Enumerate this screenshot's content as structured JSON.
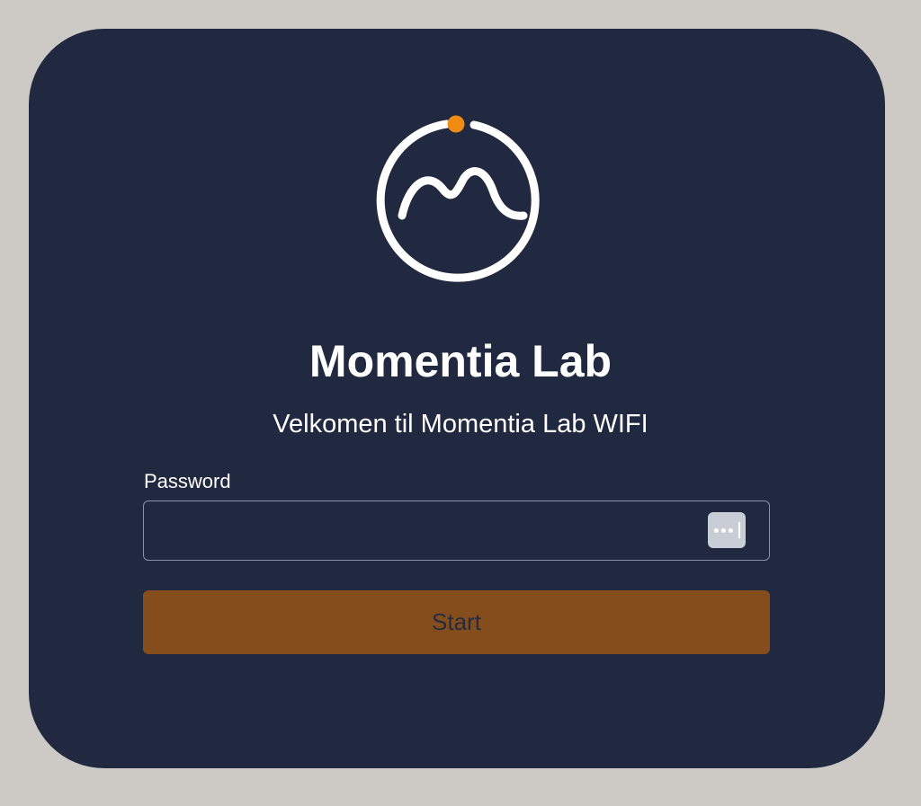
{
  "brand": {
    "logo_icon": "momentia-logo-icon",
    "title": "Momentia Lab",
    "subtitle": "Velkomen til Momentia Lab WIFI"
  },
  "form": {
    "password_label": "Password",
    "password_value": "",
    "password_manager_icon": "password-key-icon",
    "submit_label": "Start"
  },
  "colors": {
    "background": "#cdc9c5",
    "card": "#212940",
    "accent_orange": "#f08b12",
    "button": "#854d1c",
    "button_text": "#252c40",
    "text": "#ffffff"
  }
}
